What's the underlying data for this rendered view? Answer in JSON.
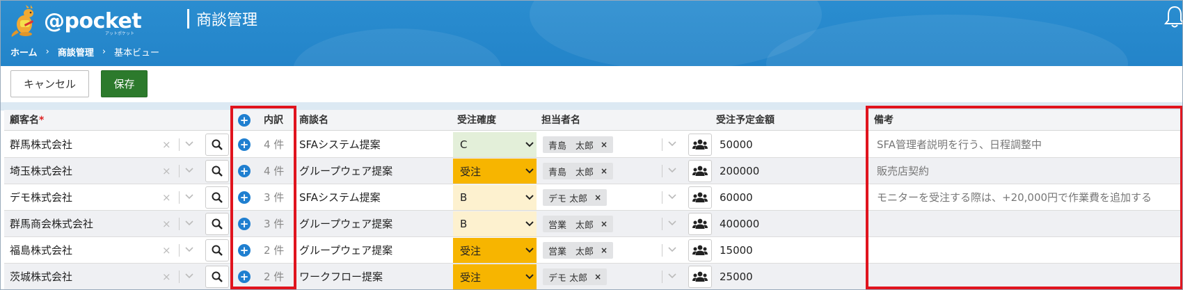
{
  "app": {
    "logo_text": "@pocket",
    "logo_sub": "アットポケット",
    "page_title": "商談管理"
  },
  "breadcrumb": [
    "ホーム",
    "商談管理",
    "基本ビュー"
  ],
  "breadcrumb_sep": "›",
  "toolbar": {
    "cancel_label": "キャンセル",
    "save_label": "保存"
  },
  "columns": {
    "customer": "顧客名",
    "required_mark": "*",
    "breakdown": "内訳",
    "deal": "商談名",
    "probability": "受注確度",
    "owner": "担当者名",
    "amount": "受注予定金額",
    "note": "備考"
  },
  "rows": [
    {
      "customer": "群馬株式会社",
      "breakdown": "4 件",
      "deal": "SFAシステム提案",
      "probability": "C",
      "prob_color": "#e3efd9",
      "owner": "青島　太郎",
      "amount": "50000",
      "note": "SFA管理者説明を行う、日程調整中"
    },
    {
      "customer": "埼玉株式会社",
      "breakdown": "4 件",
      "deal": "グループウェア提案",
      "probability": "受注",
      "prob_color": "#f7b500",
      "owner": "青島　太郎",
      "amount": "200000",
      "note": "販売店契約"
    },
    {
      "customer": "デモ株式会社",
      "breakdown": "3 件",
      "deal": "SFAシステム提案",
      "probability": "B",
      "prob_color": "#fdf1cf",
      "owner": "デモ 太郎",
      "amount": "60000",
      "note": "モニターを受注する際は、+20,000円で作業費を追加する"
    },
    {
      "customer": "群馬商会株式会社",
      "breakdown": "3 件",
      "deal": "グループウェア提案",
      "probability": "B",
      "prob_color": "#fdf1cf",
      "owner": "営業　太郎",
      "amount": "400000",
      "note": ""
    },
    {
      "customer": "福島株式会社",
      "breakdown": "2 件",
      "deal": "グループウェア提案",
      "probability": "受注",
      "prob_color": "#f7b500",
      "owner": "営業　太郎",
      "amount": "15000",
      "note": ""
    },
    {
      "customer": "茨城株式会社",
      "breakdown": "2 件",
      "deal": "ワークフロー提案",
      "probability": "受注",
      "prob_color": "#f7b500",
      "owner": "デモ 太郎",
      "amount": "25000",
      "note": ""
    }
  ],
  "icons": {
    "clear": "×",
    "chip_remove": "×",
    "add": "+"
  },
  "colors": {
    "header_blue": "#2384c9",
    "save_green": "#2c7a2c",
    "add_blue": "#1f7fd0",
    "highlight_red": "#e0141e"
  }
}
